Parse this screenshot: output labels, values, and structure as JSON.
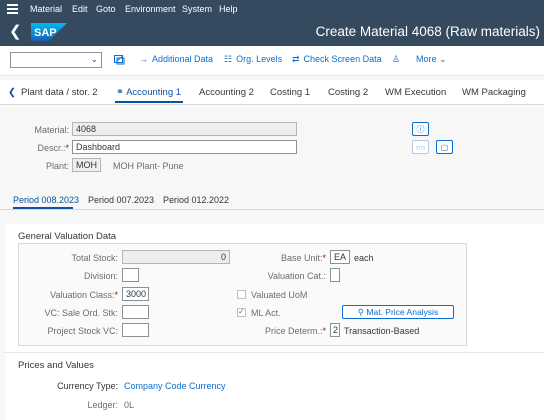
{
  "menubar": {
    "items": [
      "Material",
      "Edit",
      "Goto",
      "Environment",
      "System",
      "Help"
    ]
  },
  "titlebar": {
    "logo_text": "SAP",
    "title": "Create Material 4068 (Raw materials)"
  },
  "toolbar": {
    "dropdown_value": "",
    "additional_data": "Additional Data",
    "org_levels": "Org. Levels",
    "check_screen_data": "Check Screen Data",
    "more": "More"
  },
  "tabs": {
    "items": [
      "Plant data / stor. 2",
      "Accounting 1",
      "Accounting 2",
      "Costing 1",
      "Costing 2",
      "WM Execution",
      "WM Packaging"
    ],
    "active": "Accounting 1"
  },
  "header": {
    "material_label": "Material:",
    "material_value": "4068",
    "descr_label": "Descr.:",
    "descr_value": "Dashboard",
    "plant_label": "Plant:",
    "plant_value": "MOH",
    "plant_text": "MOH Plant- Pune"
  },
  "period_tabs": {
    "items": [
      "Period 008.2023",
      "Period 007.2023",
      "Period 012.2022"
    ],
    "active": "Period 008.2023"
  },
  "valuation": {
    "title": "General Valuation Data",
    "total_stock_label": "Total Stock:",
    "total_stock_value": "0",
    "division_label": "Division:",
    "division_value": "",
    "valuation_class_label": "Valuation Class:",
    "valuation_class_value": "3000",
    "vc_sales_label": "VC: Sale Ord. Stk:",
    "vc_sales_value": "",
    "project_stock_label": "Project Stock VC:",
    "project_stock_value": "",
    "base_unit_label": "Base Unit:",
    "base_unit_value": "EA",
    "base_unit_text": "each",
    "valuation_cat_label": "Valuation Cat.:",
    "valuation_cat_value": "",
    "valuated_uom_label": "Valuated UoM",
    "valuated_uom_checked": false,
    "ml_act_label": "ML Act.",
    "ml_act_checked": true,
    "mat_price_analysis": "Mat. Price Analysis",
    "price_determ_label": "Price Determ.:",
    "price_determ_value": "2",
    "price_determ_text": "Transaction-Based"
  },
  "prices": {
    "title": "Prices and Values",
    "currency_type_label": "Currency Type:",
    "currency_type_value": "Company Code Currency",
    "ledger_label": "Ledger:",
    "ledger_value": "0L"
  },
  "colors": {
    "shell": "#354a5f",
    "accent": "#0a6ed1",
    "active_tab": "#0854a0"
  }
}
